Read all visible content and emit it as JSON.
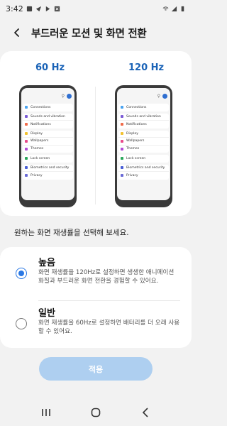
{
  "status_bar": {
    "time": "3:42"
  },
  "header": {
    "title": "부드러운 모션 및 화면 전환"
  },
  "preview": {
    "left_hz": "60 Hz",
    "right_hz": "120 Hz",
    "settings_items": [
      "Connections",
      "Sounds and vibration",
      "Notifications",
      "Display",
      "Wallpapers",
      "Themes",
      "Lock screen",
      "Biometrics and security",
      "Privacy"
    ]
  },
  "hint": "원하는 화면 재생률을 선택해 보세요.",
  "options": [
    {
      "title": "높음",
      "description": "화면 재생률을 120Hz로 설정하면 생생한 애니메이션 화질과 부드러운 화면 전환을 경험할 수 있어요.",
      "selected": true
    },
    {
      "title": "일반",
      "description": "화면 재생률을 60Hz로 설정하면 배터리를 더 오래 사용할 수 있어요.",
      "selected": false
    }
  ],
  "apply_label": "적용",
  "colors": {
    "accent": "#2a78e4",
    "hz_label": "#1a63b7",
    "apply_disabled": "#aecff0"
  },
  "icons": [
    "back-arrow",
    "recents",
    "home",
    "back"
  ]
}
